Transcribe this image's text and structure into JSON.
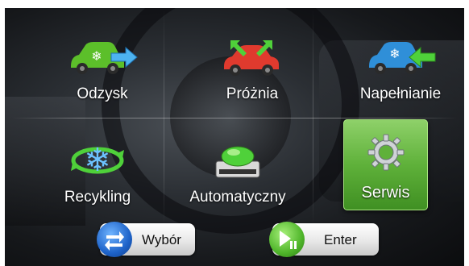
{
  "menu": {
    "items": [
      {
        "id": "odzysk",
        "label": "Odzysk",
        "icon": "car-recovery-icon"
      },
      {
        "id": "proznia",
        "label": "Próżnia",
        "icon": "car-vacuum-icon"
      },
      {
        "id": "napelnianie",
        "label": "Napełnianie",
        "icon": "car-charge-icon"
      },
      {
        "id": "recykling",
        "label": "Recykling",
        "icon": "recycle-snowflake-icon"
      },
      {
        "id": "automatyczny",
        "label": "Automatyczny",
        "icon": "machine-icon"
      },
      {
        "id": "serwis",
        "label": "Serwis",
        "icon": "gear-icon",
        "selected": true
      }
    ]
  },
  "footer": {
    "select_label": "Wybór",
    "enter_label": "Enter"
  },
  "colors": {
    "green_car": "#5cbf2a",
    "red_car": "#e03a2e",
    "blue_car": "#2f8fd8",
    "arrow_blue": "#4db3f0",
    "arrow_green": "#4fd13a",
    "selected_tile": "#5fb13a"
  }
}
